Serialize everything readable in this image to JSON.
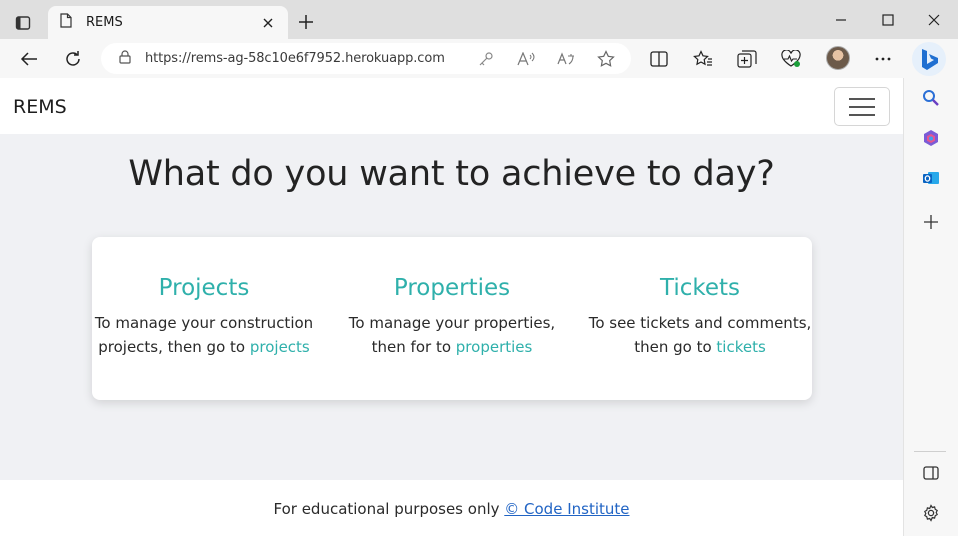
{
  "browser": {
    "tab_title": "REMS",
    "url": "https://rems-ag-58c10e6f7952.herokuapp.com",
    "icons": {
      "tab_actions": "tab-actions-icon",
      "page": "page-icon",
      "close": "close-icon",
      "new_tab": "plus-icon",
      "minimize": "minimize-icon",
      "maximize": "maximize-icon",
      "window_close": "close-icon",
      "back": "back-arrow-icon",
      "refresh": "refresh-icon",
      "lock": "lock-icon",
      "key": "key-icon",
      "read_aloud": "read-aloud-icon",
      "translate": "translate-icon",
      "favorite": "star-icon",
      "split_screen": "split-screen-icon",
      "favorites": "favorites-icon",
      "collections": "collections-icon",
      "browser_essentials": "heart-pulse-icon",
      "more": "more-icon",
      "copilot": "bing-copilot-icon"
    }
  },
  "sidebar": {
    "icons": [
      "search-icon",
      "microsoft365-icon",
      "outlook-icon",
      "add-icon",
      "sidebar-panel-icon",
      "settings-icon"
    ]
  },
  "navbar": {
    "brand": "REMS"
  },
  "main": {
    "headline": "What do you want to achieve to day?",
    "columns": [
      {
        "title": "Projects",
        "text_line1": "To manage your construction",
        "text_line2_prefix": "projects, then go to ",
        "link": "projects"
      },
      {
        "title": "Properties",
        "text_line1": "To manage your properties,",
        "text_line2_prefix": "then for to ",
        "link": "properties"
      },
      {
        "title": "Tickets",
        "text_line1": "To see tickets and comments,",
        "text_line2_prefix": "then go to ",
        "link": "tickets"
      }
    ]
  },
  "footer": {
    "text": "For educational purposes only ",
    "link": "© Code Institute"
  },
  "colors": {
    "accent": "#2fb0ab",
    "page_bg": "#f0f1f4",
    "footer_link": "#2164c4"
  }
}
